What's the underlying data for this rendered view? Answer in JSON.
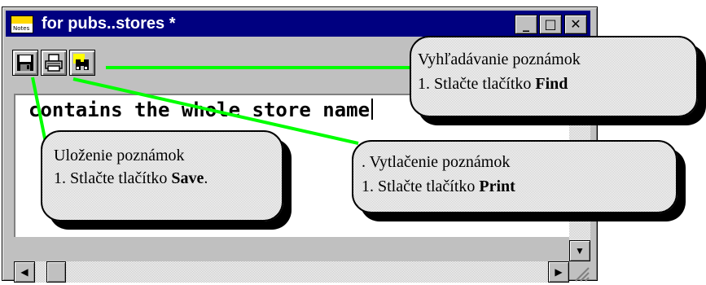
{
  "window": {
    "title": "for pubs..stores *",
    "icon": "notepad-icon",
    "controls": {
      "minimize": "_",
      "maximize": "□",
      "close": "✕"
    }
  },
  "toolbar": {
    "buttons": [
      {
        "name": "save",
        "icon": "floppy-disk-icon"
      },
      {
        "name": "print",
        "icon": "printer-icon"
      },
      {
        "name": "find",
        "icon": "binoculars-icon"
      }
    ]
  },
  "editor": {
    "text": "contains the whole store name"
  },
  "scrollbars": {
    "up": "▲",
    "down": "▼",
    "left": "◀",
    "right": "▶"
  },
  "callouts": {
    "find": {
      "title": "Vyhľadávanie poznámok",
      "step_prefix": "1.   Stlačte tlačítko ",
      "button": "Find",
      "step_suffix": ""
    },
    "save": {
      "title": "Uloženie poznámok",
      "step_prefix": "1.   Stlačte tlačítko ",
      "button": "Save",
      "step_suffix": "."
    },
    "print": {
      "title": ". Vytlačenie poznámok",
      "step_prefix": "1.   Stlačte tlačítko ",
      "button": "Print",
      "step_suffix": ""
    }
  },
  "colors": {
    "title_bar": "#000080",
    "connector": "#00ff00",
    "window_face": "#c0c0c0",
    "icon_band": "#ffd800"
  }
}
